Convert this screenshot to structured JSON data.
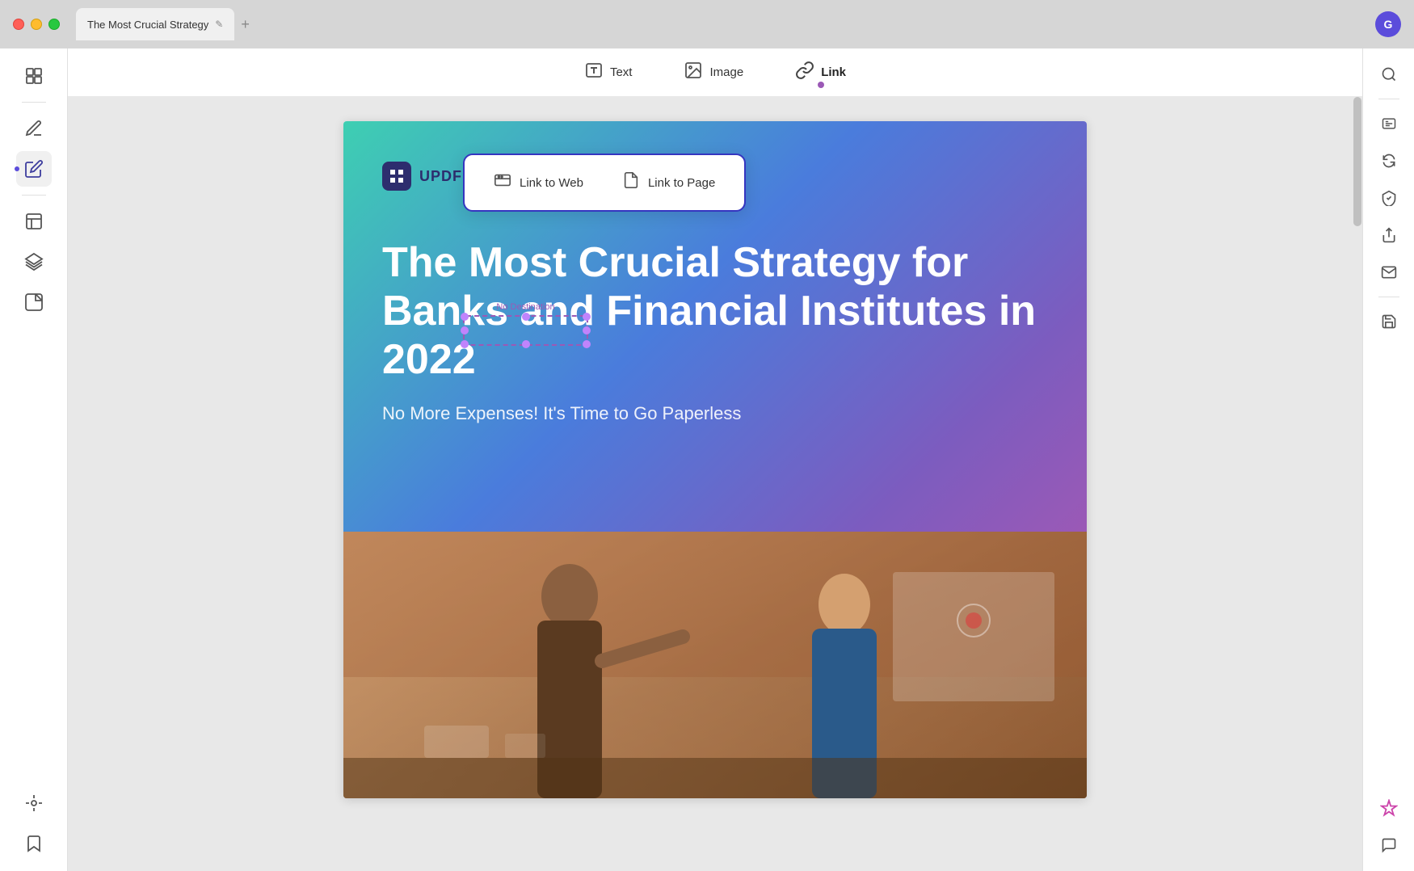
{
  "titlebar": {
    "tab_title": "The Most Crucial Strategy",
    "edit_icon": "✎",
    "add_tab_icon": "+",
    "user_initial": "G"
  },
  "toolbar": {
    "items": [
      {
        "id": "text",
        "label": "Text",
        "icon": "text-icon"
      },
      {
        "id": "image",
        "label": "Image",
        "icon": "image-icon"
      },
      {
        "id": "link",
        "label": "Link",
        "icon": "link-icon",
        "active": true
      }
    ]
  },
  "link_popup": {
    "options": [
      {
        "id": "link-to-web",
        "label": "Link to Web",
        "icon": "url-icon"
      },
      {
        "id": "link-to-page",
        "label": "Link to Page",
        "icon": "page-icon"
      }
    ]
  },
  "selected_element": {
    "no_destination_label": "No Destination"
  },
  "content": {
    "logo_text": "UPDF",
    "hero_title": "The Most Crucial Strategy for Banks and Financial Institutes in 2022",
    "hero_subtitle": "No More Expenses! It's Time to Go Paperless"
  },
  "left_sidebar": {
    "icons": [
      {
        "id": "pages-icon",
        "label": "Pages",
        "symbol": "⊞"
      },
      {
        "id": "pen-icon",
        "label": "Pen",
        "symbol": "✒"
      },
      {
        "id": "markup-icon",
        "label": "Markup",
        "symbol": "📝",
        "active": true
      },
      {
        "id": "templates-icon",
        "label": "Templates",
        "symbol": "⊟"
      },
      {
        "id": "layers-icon",
        "label": "Layers",
        "symbol": "◫"
      },
      {
        "id": "stickers-icon",
        "label": "Stickers",
        "symbol": "❐"
      }
    ],
    "bottom_icons": [
      {
        "id": "layers-bottom-icon",
        "symbol": "⊙"
      },
      {
        "id": "bookmark-icon",
        "symbol": "🔖"
      }
    ]
  },
  "right_sidebar": {
    "icons": [
      {
        "id": "search-icon",
        "symbol": "🔍"
      },
      {
        "id": "ocr-icon",
        "symbol": "OCR"
      },
      {
        "id": "sync-icon",
        "symbol": "⟳"
      },
      {
        "id": "secure-icon",
        "symbol": "🔒"
      },
      {
        "id": "share-icon",
        "symbol": "↑"
      },
      {
        "id": "mail-icon",
        "symbol": "✉"
      },
      {
        "id": "save-icon",
        "symbol": "💾"
      }
    ],
    "bottom_icons": [
      {
        "id": "ai-icon",
        "symbol": "✳"
      },
      {
        "id": "chat-icon",
        "symbol": "💬"
      }
    ]
  }
}
